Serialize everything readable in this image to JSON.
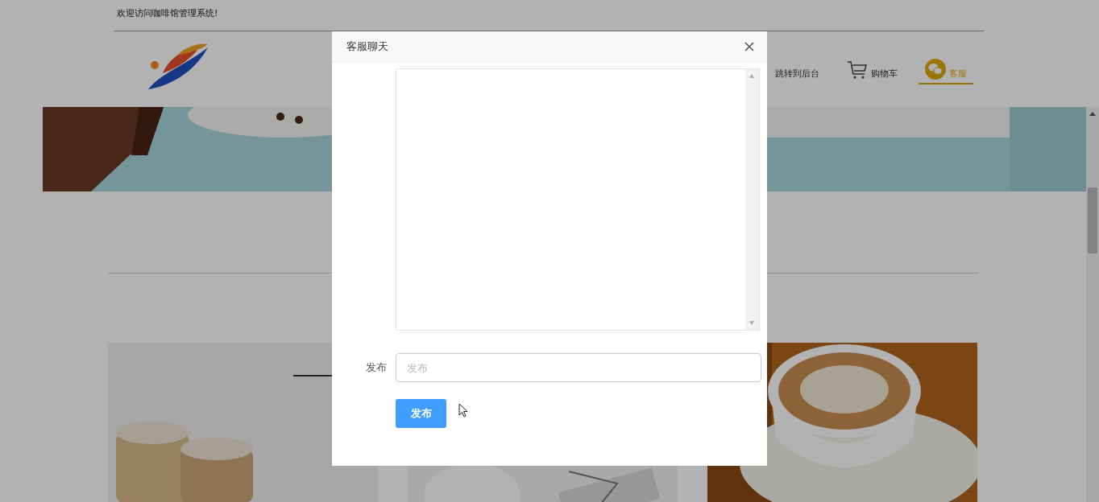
{
  "top_bar": {
    "welcome": "欢迎访问咖啡馆管理系统!"
  },
  "nav": [
    {
      "label": "跳转到后台",
      "kind": "text",
      "selected": false
    },
    {
      "label": "购物车",
      "kind": "cart",
      "selected": false
    },
    {
      "label": "客服",
      "kind": "chat",
      "selected": true
    }
  ],
  "dialog": {
    "title": "客服聊天",
    "field_label": "发布",
    "placeholder": "发布",
    "submit": "发布"
  }
}
